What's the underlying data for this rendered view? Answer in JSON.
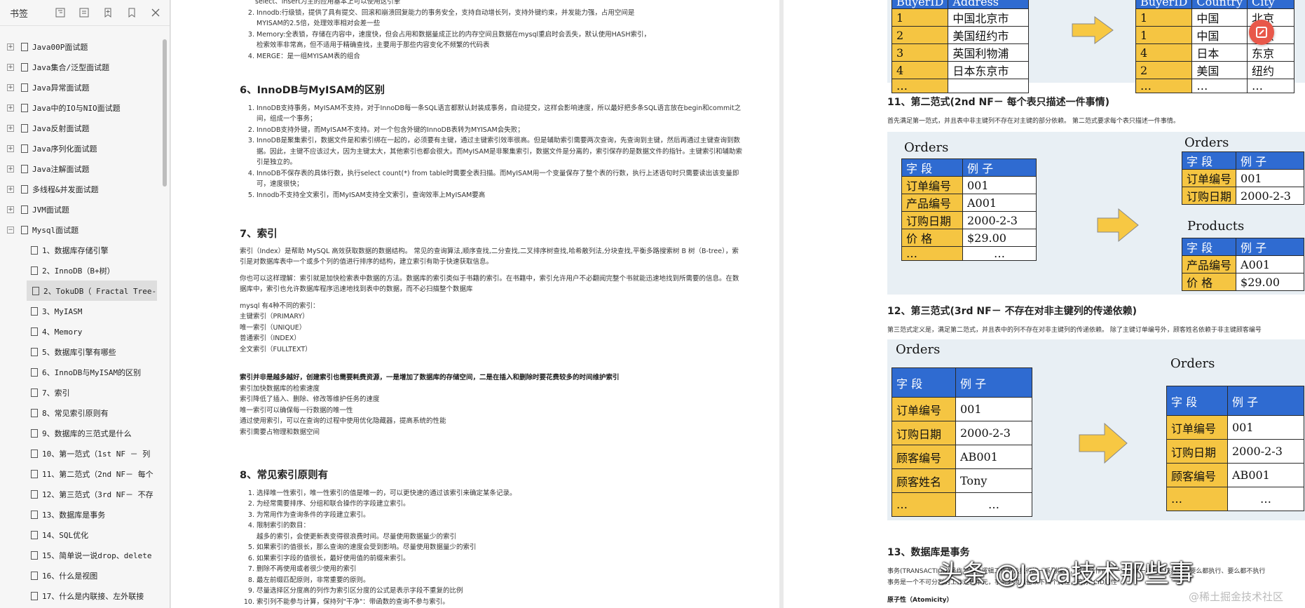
{
  "sidebar": {
    "title": "书签",
    "top_items": [
      {
        "label": "Java00P面试题"
      },
      {
        "label": "Java集合/泛型面试题"
      },
      {
        "label": "Java异常面试题"
      },
      {
        "label": "Java中的IO与NIO面试题"
      },
      {
        "label": "Java反射面试题"
      },
      {
        "label": "Java序列化面试题"
      },
      {
        "label": "Java注解面试题"
      },
      {
        "label": "多线程&并发面试题"
      },
      {
        "label": "JVM面试题"
      },
      {
        "label": "Mysql面试题"
      }
    ],
    "children": [
      {
        "label": "1、数据库存储引擎"
      },
      {
        "label": "2、InnoDB（B+树）"
      },
      {
        "label": "2、TokuDB（ Fractal Tree-"
      },
      {
        "label": "3、MyIASM"
      },
      {
        "label": "4、Memory"
      },
      {
        "label": "5、数据库引擎有哪些"
      },
      {
        "label": "6、InnoDB与MyISAM的区别"
      },
      {
        "label": "7、索引"
      },
      {
        "label": "8、常见索引原则有"
      },
      {
        "label": "9、数据库的三范式是什么"
      },
      {
        "label": "10、第一范式（1st NF － 列"
      },
      {
        "label": "11、第二范式（2nd NF－ 每个"
      },
      {
        "label": "12、第三范式（3rd NF－ 不存"
      },
      {
        "label": "13、数据库是事务"
      },
      {
        "label": "14、SQL优化"
      },
      {
        "label": "15、简单说一说drop、delete"
      },
      {
        "label": "16、什么是视图"
      },
      {
        "label": "17、什么是内联接、左外联接"
      }
    ]
  },
  "page1": {
    "top_lines": [
      "select、insert为主的应用基本上可以使用这引擎",
      "Innodb:行级锁，提供了具有提交、回滚和崩溃回复能力的事务安全，支持自动增长列，支持外键约束，并发能力强，占用空间是",
      "MYISAM的2.5倍，处理效率相对会差一些",
      "Memory:全表锁，存储在内容中，速度快，但会占用和数据量成正比的内存空间且数据在mysql重启时会丢失，默认使用HASH索引，",
      "检索效率非常高，但不适用于精确查找，主要用于那些内容变化不频繁的代码表",
      "MERGE：是一组MYISAM表的组合"
    ],
    "s6_title": "6、InnoDB与MyISAM的区别",
    "s6_items": [
      "InnoDB支持事务，MyISAM不支持，对于InnoDB每一条SQL语言都默认封装成事务，自动提交，这样会影响速度，所以最好把多条SQL语言放在begin和commit之间，组成一个事务；",
      "InnoDB支持外键，而MyISAM不支持。对一个包含外键的InnoDB表转为MYISAM会失败；",
      "InnoDB是聚集索引，数据文件是和索引绑在一起的，必须要有主键，通过主键索引效率很高。但是辅助索引需要两次查询，先查询到主键，然后再通过主键查询到数据。因此，主键不应该过大，因为主键太大，其他索引也都会很大。而MyISAM是非聚集索引，数据文件是分离的，索引保存的是数据文件的指针。主键索引和辅助索引是独立的。",
      "InnoDB不保存表的具体行数，执行select count(*) from table时需要全表扫描。而MyISAM用一个变量保存了整个表的行数，执行上述语句时只需要读出该变量即可，速度很快；",
      "Innodb不支持全文索引，而MyISAM支持全文索引，查询效率上MyISAM要高"
    ],
    "s7_title": "7、索引",
    "s7_p1": "索引（Index）是帮助 MySQL 高效获取数据的数据结构。 常见的查询算法,顺序查找,二分查找,二叉排序树查找,哈希散列法,分块查找,平衡多路搜索树 B 树（B-tree），索引是对数据库表中一个或多个列的值进行排序的结构，建立索引有助于快速获取信息。",
    "s7_p2": "你也可以这样理解：索引就是加快检索表中数据的方法。数据库的索引类似于书籍的索引。在书籍中，索引允许用户不必翻阅完整个书就能迅速地找到所需要的信息。在数据库中，索引也允许数据库程序迅速地找到表中的数据，而不必扫描整个数据库",
    "s7_types": [
      "mysql 有4种不同的索引：",
      "主键索引（PRIMARY）",
      "唯一索引（UNIQUE）",
      "普通索引（INDEX）",
      "全文索引（FULLTEXT）"
    ],
    "s7_bold": "索引并非是越多越好，创建索引也需要耗费资源，一是增加了数据库的存储空间，二是在插入和删除时要花费较多的时间维护索引",
    "s7_notes": [
      "索引加快数据库的检索速度",
      "索引降低了插入、删除、修改等维护任务的速度",
      "唯一索引可以确保每一行数据的唯一性",
      "通过使用索引，可以在查询的过程中使用优化隐藏器，提高系统的性能",
      "索引需要占物理和数据空间"
    ],
    "s8_title": "8、常见索引原则有",
    "s8_items": [
      "选择唯一性索引，唯一性索引的值是唯一的，可以更快速的通过该索引来确定某条记录。",
      "为经常需要排序、分组和联合操作的字段建立索引。",
      "为常用作为查询条件的字段建立索引。",
      "限制索引的数目：",
      "如果索引的值很长，那么查询的速度会受到影响。尽量使用数据量少的索引",
      "如果索引字段的值很长，最好使用值的前缀来索引。",
      "删除不再使用或者很少使用的索引",
      "最左前缀匹配原则，非常重要的原则。",
      "尽量选择区分度高的列作为索引区分度的公式是表示字段不重复的比例",
      "索引列不能参与计算，保持列\"干净\"：带函数的查询不参与索引。"
    ],
    "s8_sub": "越多的索引，会使更新表变得很浪费时间。尽量使用数据量少的索引"
  },
  "page2": {
    "top_left": {
      "header": [
        "BuyerID",
        "Address"
      ],
      "rows": [
        [
          "1",
          "中国北京市"
        ],
        [
          "2",
          " 美国纽约市"
        ],
        [
          "3",
          "英国利物浦"
        ],
        [
          "4",
          "日本东京市"
        ],
        [
          "…",
          ""
        ]
      ]
    },
    "top_right": {
      "header": [
        "BuyerID",
        "Country",
        "City"
      ],
      "rows": [
        [
          "1",
          "中国",
          "北京"
        ],
        [
          "1",
          "中国",
          "北京"
        ],
        [
          "4",
          "日本",
          "东京"
        ],
        [
          "2",
          "美国",
          "纽约"
        ],
        [
          "…",
          "…",
          "…"
        ]
      ]
    },
    "s11_title": "11、第二范式(2nd NF－ 每个表只描述一件事情)",
    "s11_desc": "首先满足第一范式，并且表中非主键列不存在对主键的部分依赖。 第二范式要求每个表只描述一件事情。",
    "s11_orders_title": "Orders",
    "s11_orders": [
      [
        "字 段",
        "例 子"
      ],
      [
        "订单编号",
        "001"
      ],
      [
        "产品编号",
        "A001"
      ],
      [
        "订购日期",
        "2000-2-3"
      ],
      [
        "价 格",
        "$29.00"
      ],
      [
        "…",
        "…"
      ]
    ],
    "s11_r_orders_title": "Orders",
    "s11_r_orders": [
      [
        "字 段",
        "例 子"
      ],
      [
        "订单编号",
        "001"
      ],
      [
        "订购日期",
        "2000-2-3"
      ]
    ],
    "s11_products_title": "Products",
    "s11_products": [
      [
        "字 段",
        "例 子"
      ],
      [
        "产品编号",
        "A001"
      ],
      [
        "价 格",
        "$29.00"
      ]
    ],
    "s12_title": "12、第三范式(3rd NF－ 不存在对非主键列的传递依赖)",
    "s12_desc": "第三范式定义是，满足第二范式，并且表中的列不存在对非主键列的传递依赖。 除了主键订单编号外，顾客姓名依赖于非主键顾客编号",
    "s12_orders_title": "Orders",
    "s12_orders": [
      [
        "字 段",
        "例 子"
      ],
      [
        "订单编号",
        "001"
      ],
      [
        "订购日期",
        "2000-2-3"
      ],
      [
        "顾客编号",
        "AB001"
      ],
      [
        "顾客姓名",
        "Tony"
      ],
      [
        "…",
        "…"
      ]
    ],
    "s12_r_orders_title": "Orders",
    "s12_r_orders": [
      [
        "字 段",
        "例 子"
      ],
      [
        "订单编号",
        "001"
      ],
      [
        "订购日期",
        "2000-2-3"
      ],
      [
        "顾客编号",
        "AB001"
      ],
      [
        "…",
        "…"
      ]
    ],
    "s13_title": "13、数据库是事务",
    "s13_desc1": "事务(TRANSACTION)是作为单个逻辑工作单元执行的一系列操作，这些操作作为一个整体一起向系统提交，要么都执行、要么都不执行",
    "s13_desc2": "事务是一个不可分割的工作逻辑单元，事务必须具备以下四个属性，简称ACID属性",
    "s13_atom": "原子性（Atomicity）"
  },
  "watermark": {
    "main": "头条 @Java技术那些事",
    "sub": "@稀土掘金技术社区"
  }
}
